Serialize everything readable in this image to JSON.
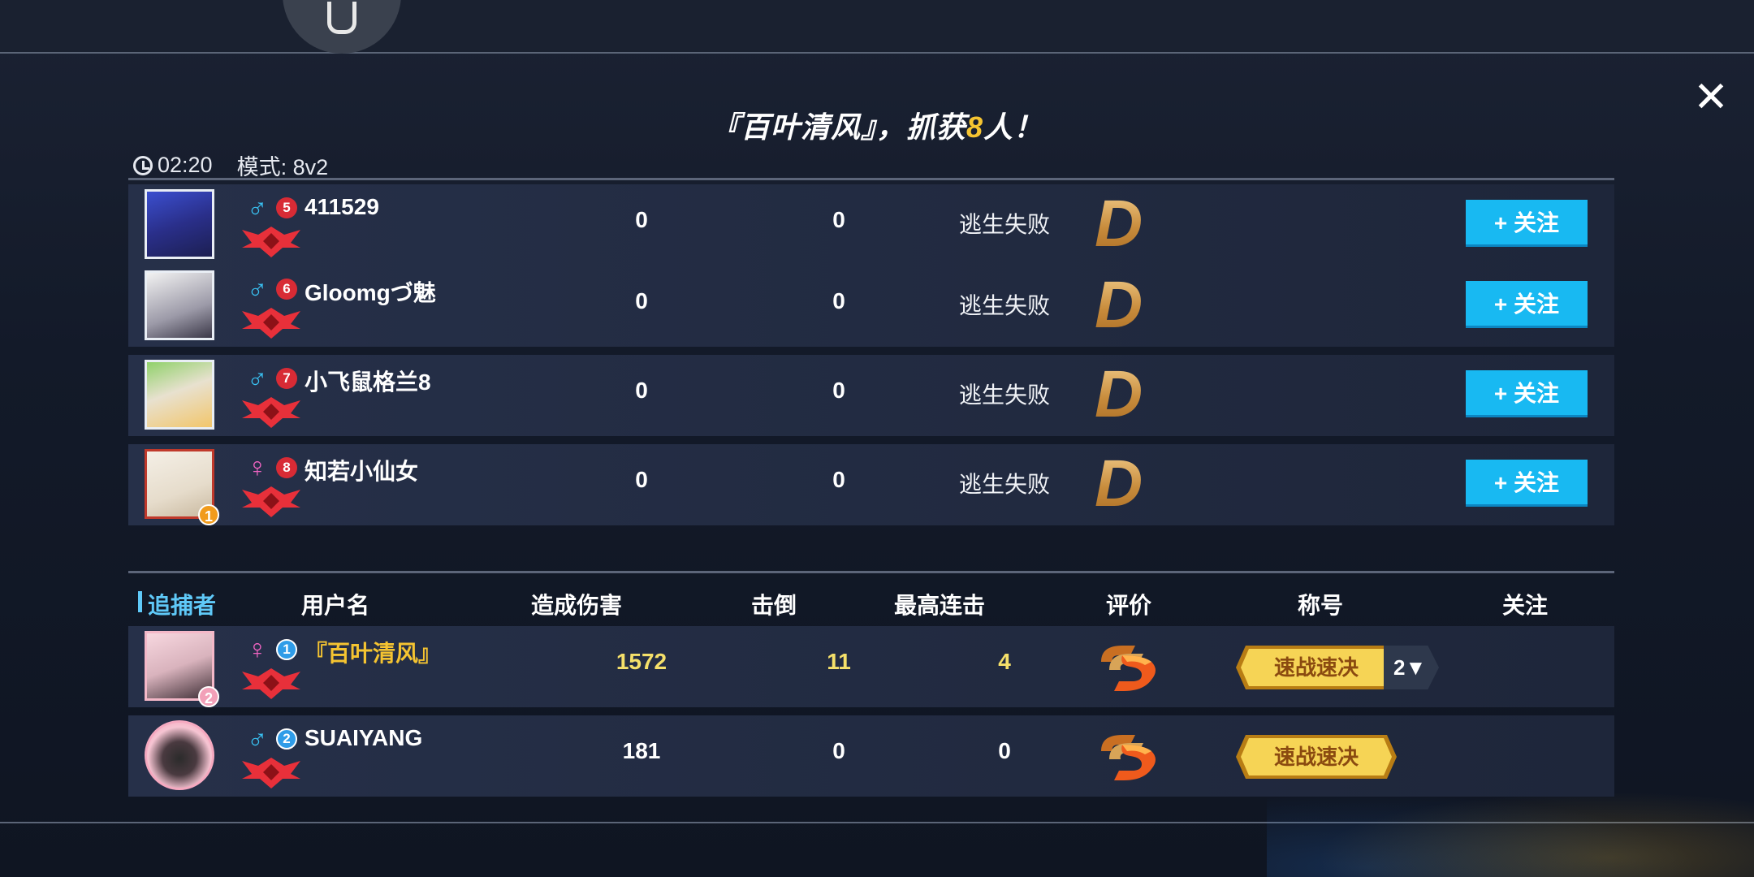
{
  "header": {
    "title_prefix": "『百叶清风』，抓获",
    "title_count": "8",
    "title_suffix": "人！",
    "time": "02:20",
    "mode": "模式: 8v2",
    "close_icon": "close-icon"
  },
  "escapers": [
    {
      "name": "411529",
      "gender": "♂",
      "level": "5",
      "col1": "0",
      "col2": "0",
      "result": "逃生失败",
      "grade": "D",
      "follow": "+ 关注"
    },
    {
      "name": "Gloomgづ魅",
      "gender": "♂",
      "level": "6",
      "col1": "0",
      "col2": "0",
      "result": "逃生失败",
      "grade": "D",
      "follow": "+ 关注"
    },
    {
      "name": "小飞鼠格兰8",
      "gender": "♂",
      "level": "7",
      "col1": "0",
      "col2": "0",
      "result": "逃生失败",
      "grade": "D",
      "follow": "+ 关注"
    },
    {
      "name": "知若小仙女",
      "gender": "♀",
      "level": "8",
      "col1": "0",
      "col2": "0",
      "result": "逃生失败",
      "grade": "D",
      "follow": "+ 关注",
      "badge": "1"
    }
  ],
  "hunter_header": {
    "role": "追捕者",
    "username": "用户名",
    "damage": "造成伤害",
    "knockdowns": "击倒",
    "max_combo": "最高连击",
    "rating": "评价",
    "title": "称号",
    "follow": "关注"
  },
  "hunters": [
    {
      "name": "『百叶清风』",
      "gender": "♀",
      "level": "1",
      "damage": "1572",
      "knockdowns": "11",
      "max_combo": "4",
      "grade": "S",
      "title": "速战速决",
      "title_count": "2▼",
      "badge": "2"
    },
    {
      "name": "SUAIYANG",
      "gender": "♂",
      "level": "2",
      "damage": "181",
      "knockdowns": "0",
      "max_combo": "0",
      "grade": "S",
      "title": "速战速决"
    }
  ],
  "colors": {
    "accent_gold": "#f5c431",
    "follow_blue": "#18b9f2",
    "male_blue": "#39c1f2",
    "female_pink": "#ef64c2"
  }
}
